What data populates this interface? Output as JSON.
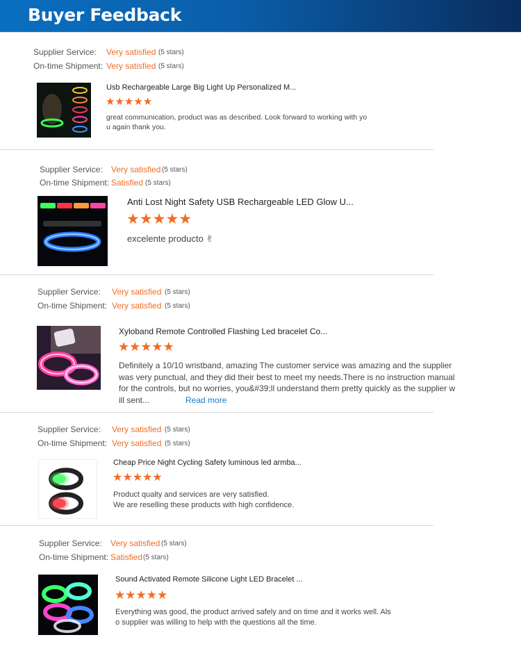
{
  "header": {
    "title": "Buyer Feedback"
  },
  "labels": {
    "supplier_service": "Supplier Service:",
    "ontime_shipment": "On-time Shipment:"
  },
  "star_glyph": "★",
  "colors": {
    "accent": "#f26c22",
    "header_blue": "#0b5ea9",
    "link": "#1a78c2"
  },
  "reviews": [
    {
      "supplier_value": "Very satisfied",
      "supplier_stars": "(5 stars)",
      "shipment_value": "Very satisfied",
      "shipment_stars": "(5 stars)",
      "product_title": "Usb Rechargeable Large Big Light Up Personalized M...",
      "rating": 5,
      "comment_lines": [
        "great communication, product was as described. Look forward to working with yo",
        "u again thank you."
      ],
      "image": "dog-collar-icon"
    },
    {
      "supplier_value": "Very satisfied",
      "supplier_stars": "(5 stars)",
      "shipment_value": "Satisfied",
      "shipment_stars": "(5 stars)",
      "product_title": "Anti Lost Night Safety USB Rechargeable LED Glow U...",
      "rating": 5,
      "comment_lines": [
        "excelente producto ✌"
      ],
      "image": "led-collar-icon"
    },
    {
      "supplier_value": "Very satisfied",
      "supplier_stars": "(5 stars)",
      "shipment_value": "Very satisfied",
      "shipment_stars": "(5 stars)",
      "product_title": "Xyloband Remote Controlled Flashing Led bracelet Co...",
      "rating": 5,
      "comment_lines": [
        "Definitely a 10/10 wristband, amazing The customer service was amazing and the supplier",
        "was very punctual, and they did their best to meet my needs.There is no instruction manual",
        "for the controls, but no worries, you&#39;ll understand them pretty quickly as the supplier w",
        "ill sent..."
      ],
      "read_more": "Read more",
      "image": "wristband-icon"
    },
    {
      "supplier_value": "Very satisfied",
      "supplier_stars": "(5 stars)",
      "shipment_value": "Very satisfied",
      "shipment_stars": "(5 stars)",
      "product_title": "Cheap Price Night Cycling Safety luminous led armba...",
      "rating": 5,
      "comment_lines": [
        "Product qualty and services are very satisfied.",
        "We are reselling these products with high confidence."
      ],
      "image": "armband-icon"
    },
    {
      "supplier_value": "Very satisfied",
      "supplier_stars": "(5 stars)",
      "shipment_value": "Satisfied",
      "shipment_stars": "(5 stars)",
      "product_title": "Sound Activated Remote Silicone Light LED Bracelet ...",
      "rating": 5,
      "comment_lines": [
        "Everything was good, the product arrived safely and on time and it works well. Als",
        "o supplier was willing to help with the questions all the time."
      ],
      "image": "bracelet-icon"
    }
  ]
}
